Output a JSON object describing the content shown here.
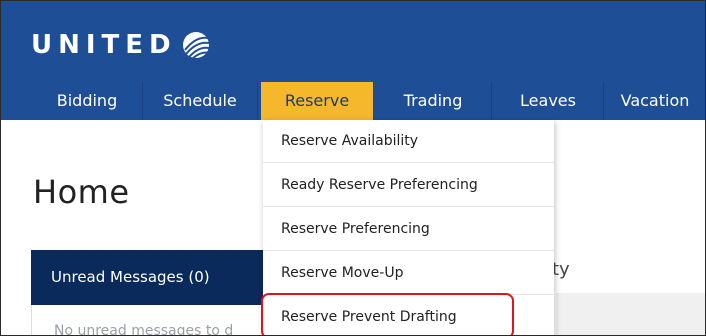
{
  "brand": {
    "name": "UNITED",
    "logo_icon": "united-globe-icon"
  },
  "nav": {
    "items": [
      {
        "label": "Bidding",
        "active": false
      },
      {
        "label": "Schedule",
        "active": false
      },
      {
        "label": "Reserve",
        "active": true
      },
      {
        "label": "Trading",
        "active": false
      },
      {
        "label": "Leaves",
        "active": false
      },
      {
        "label": "Vacation",
        "active": false
      }
    ]
  },
  "dropdown": {
    "items": [
      {
        "label": "Reserve Availability"
      },
      {
        "label": "Ready Reserve Preferencing"
      },
      {
        "label": "Reserve Preferencing"
      },
      {
        "label": "Reserve Move-Up"
      },
      {
        "label": "Reserve Prevent Drafting",
        "highlighted": true
      }
    ]
  },
  "page": {
    "title": "Home",
    "messages_panel": {
      "label": "Unread Messages (0)",
      "empty_text": "No unread messages to d"
    },
    "partial_heading": "ity"
  },
  "colors": {
    "header_bg": "#1e4f96",
    "active_tab": "#f5b72c",
    "panel_dark": "#0a2a5c",
    "highlight_border": "#e0141e"
  }
}
